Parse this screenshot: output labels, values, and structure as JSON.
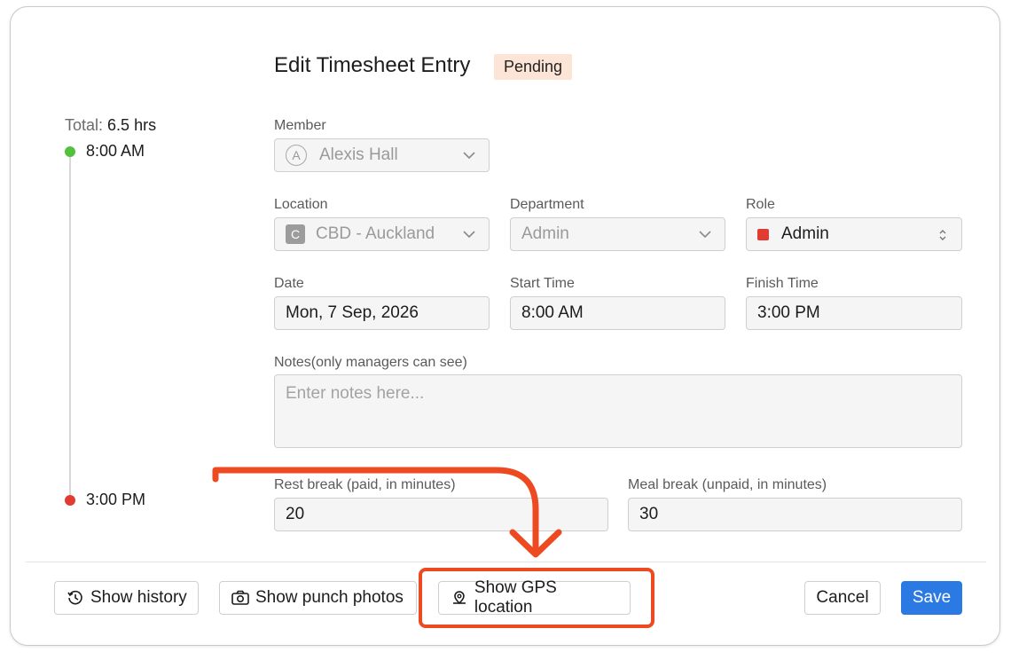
{
  "header": {
    "title": "Edit Timesheet Entry",
    "status_badge": "Pending"
  },
  "timeline": {
    "total_label": "Total:",
    "total_value": "6.5 hrs",
    "start_time": "8:00 AM",
    "end_time": "3:00 PM"
  },
  "form": {
    "member": {
      "label": "Member",
      "avatar_initial": "A",
      "value": "Alexis Hall"
    },
    "location": {
      "label": "Location",
      "badge_initial": "C",
      "value": "CBD - Auckland"
    },
    "department": {
      "label": "Department",
      "value": "Admin"
    },
    "role": {
      "label": "Role",
      "value": "Admin",
      "color": "#e23c32"
    },
    "date": {
      "label": "Date",
      "value": "Mon, 7 Sep, 2026"
    },
    "start_time": {
      "label": "Start Time",
      "value": "8:00 AM"
    },
    "finish_time": {
      "label": "Finish Time",
      "value": "3:00 PM"
    },
    "notes": {
      "label": "Notes(only managers can see)",
      "placeholder": "Enter notes here..."
    },
    "rest_break": {
      "label": "Rest break (paid, in minutes)",
      "value": "20"
    },
    "meal_break": {
      "label": "Meal break (unpaid, in minutes)",
      "value": "30"
    }
  },
  "footer": {
    "show_history": "Show history",
    "show_punch_photos": "Show punch photos",
    "show_gps_location": "Show GPS location",
    "cancel": "Cancel",
    "save": "Save"
  },
  "colors": {
    "accent": "#2b7ae4",
    "annotation": "#ee4a22",
    "badge_bg": "#fce4d6"
  }
}
